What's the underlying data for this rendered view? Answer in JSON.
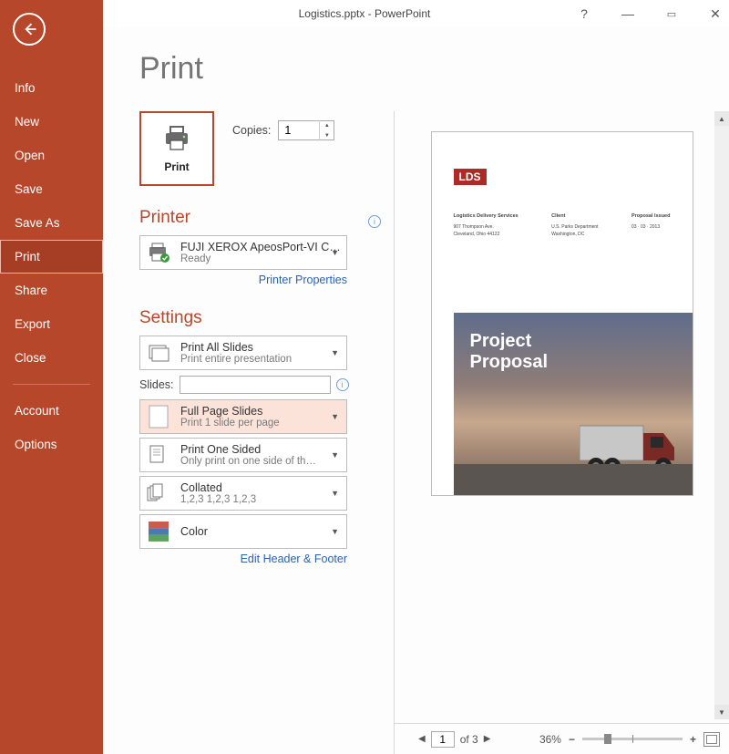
{
  "window": {
    "title": "Logistics.pptx - PowerPoint"
  },
  "sidebar": {
    "items": [
      {
        "label": "Info"
      },
      {
        "label": "New"
      },
      {
        "label": "Open"
      },
      {
        "label": "Save"
      },
      {
        "label": "Save As"
      },
      {
        "label": "Print",
        "active": true
      },
      {
        "label": "Share"
      },
      {
        "label": "Export"
      },
      {
        "label": "Close"
      }
    ],
    "bottom": [
      {
        "label": "Account"
      },
      {
        "label": "Options"
      }
    ]
  },
  "page": {
    "title": "Print"
  },
  "print_button": {
    "label": "Print"
  },
  "copies": {
    "label": "Copies:",
    "value": "1"
  },
  "printer": {
    "heading": "Printer",
    "name": "FUJI XEROX ApeosPort-VI C3…",
    "status": "Ready",
    "properties_link": "Printer Properties"
  },
  "settings": {
    "heading": "Settings",
    "slides_label": "Slides:",
    "slides_value": "",
    "edit_header_link": "Edit Header & Footer",
    "options": [
      {
        "title": "Print All Slides",
        "sub": "Print entire presentation"
      },
      {
        "title": "Full Page Slides",
        "sub": "Print 1 slide per page",
        "highlight": true
      },
      {
        "title": "Print One Sided",
        "sub": "Only print on one side of th…"
      },
      {
        "title": "Collated",
        "sub": "1,2,3    1,2,3    1,2,3"
      },
      {
        "title": "Color",
        "sub": ""
      }
    ]
  },
  "preview": {
    "lds": "LDS",
    "cols": [
      {
        "h": "Logistics Delivery Services",
        "l1": "907 Thompson Ave.",
        "l2": "Cleveland, Ohio 44122"
      },
      {
        "h": "Client",
        "l1": "U.S. Parks Department",
        "l2": "Washington, DC"
      },
      {
        "h": "Proposal Issued",
        "l1": "03 · 03 · 2013",
        "l2": ""
      }
    ],
    "photo_title_line1": "Project",
    "photo_title_line2": "Proposal"
  },
  "status": {
    "page_value": "1",
    "page_total": "of 3",
    "zoom": "36%"
  }
}
